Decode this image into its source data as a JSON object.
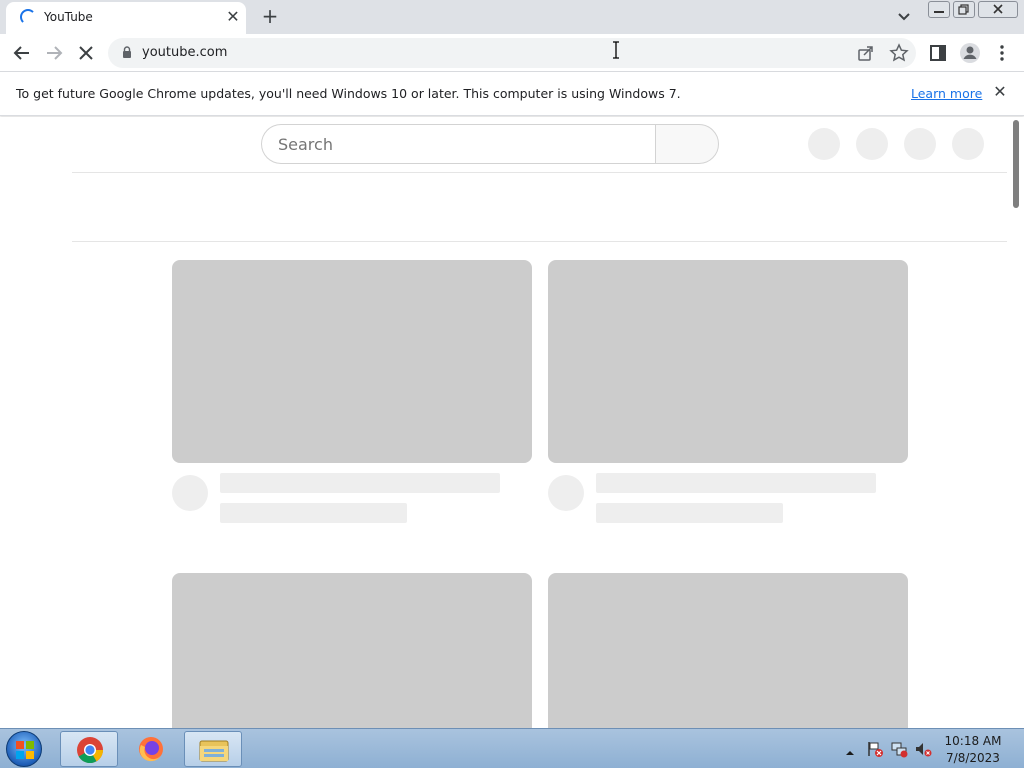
{
  "browser": {
    "tab": {
      "title": "YouTube"
    },
    "address": {
      "url": "youtube.com"
    }
  },
  "infobar": {
    "message": "To get future Google Chrome updates, you'll need Windows 10 or later. This computer is using Windows 7.",
    "link": "Learn more"
  },
  "page": {
    "search_placeholder": "Search"
  },
  "taskbar": {
    "time": "10:18 AM",
    "date": "7/8/2023"
  },
  "colors": {
    "accent": "#1a73e8",
    "skeleton_thumb": "#cccccc",
    "skeleton_line": "#eeeeee"
  }
}
